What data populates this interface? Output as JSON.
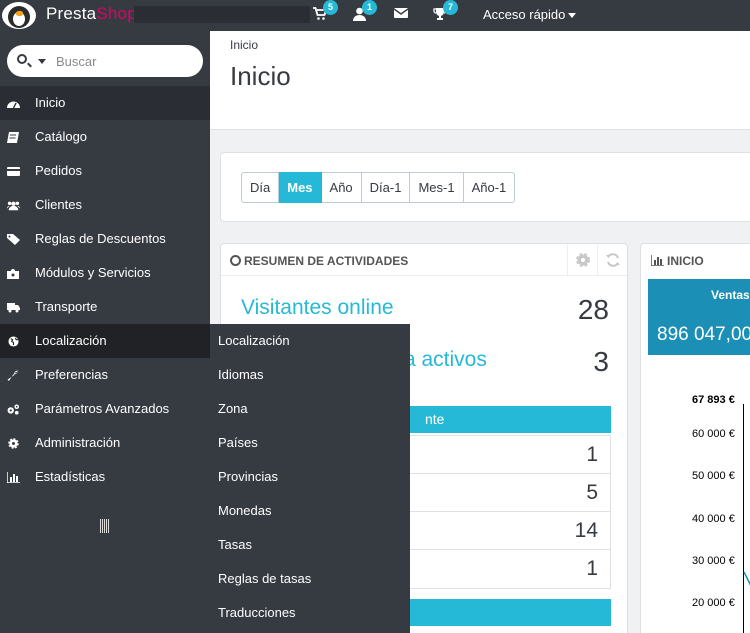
{
  "topbar": {
    "brand_prefix": "Presta",
    "brand_suffix": "Shop",
    "cart_badge": "5",
    "customers_badge": "1",
    "trophy_badge": "7",
    "quick_access": "Acceso rápido"
  },
  "sidebar": {
    "search_placeholder": "Buscar",
    "items": [
      {
        "label": "Inicio",
        "icon": "dashboard-icon"
      },
      {
        "label": "Catálogo",
        "icon": "book-icon"
      },
      {
        "label": "Pedidos",
        "icon": "credit-card-icon"
      },
      {
        "label": "Clientes",
        "icon": "users-icon"
      },
      {
        "label": "Reglas de Descuentos",
        "icon": "tags-icon"
      },
      {
        "label": "Módulos y Servicios",
        "icon": "puzzle-icon"
      },
      {
        "label": "Transporte",
        "icon": "truck-icon"
      },
      {
        "label": "Localización",
        "icon": "globe-icon"
      },
      {
        "label": "Preferencias",
        "icon": "wrench-icon"
      },
      {
        "label": "Parámetros Avanzados",
        "icon": "cogs-icon"
      },
      {
        "label": "Administración",
        "icon": "cog-icon"
      },
      {
        "label": "Estadísticas",
        "icon": "bar-chart-icon"
      }
    ]
  },
  "submenu": {
    "items": [
      "Localización",
      "Idiomas",
      "Zona",
      "Países",
      "Provincias",
      "Monedas",
      "Tasas",
      "Reglas de tasas",
      "Traducciones"
    ]
  },
  "header": {
    "breadcrumb": "Inicio",
    "title": "Inicio"
  },
  "period": {
    "buttons": [
      "Día",
      "Mes",
      "Año",
      "Día-1",
      "Mes-1",
      "Año-1"
    ],
    "active": "Mes"
  },
  "activity": {
    "title": "RESUMEN DE ACTIVIDADES",
    "visitors_label": "Visitantes online",
    "visitors_value": "28",
    "carts_label": "ra activos",
    "carts_value": "3",
    "section1_label": "nte",
    "rows": [
      "1",
      "5",
      "14",
      "1"
    ]
  },
  "stats": {
    "title": "INICIO",
    "sales_label": "Ventas",
    "sales_value": "896 047,00",
    "ymax": "67 893 €",
    "yticks": [
      "60 000 €",
      "50 000 €",
      "40 000 €",
      "30 000 €",
      "20 000 €"
    ]
  },
  "colors": {
    "accent": "#25b9d7",
    "sidebar_bg": "#363a41",
    "brand_pink": "#df0067"
  }
}
